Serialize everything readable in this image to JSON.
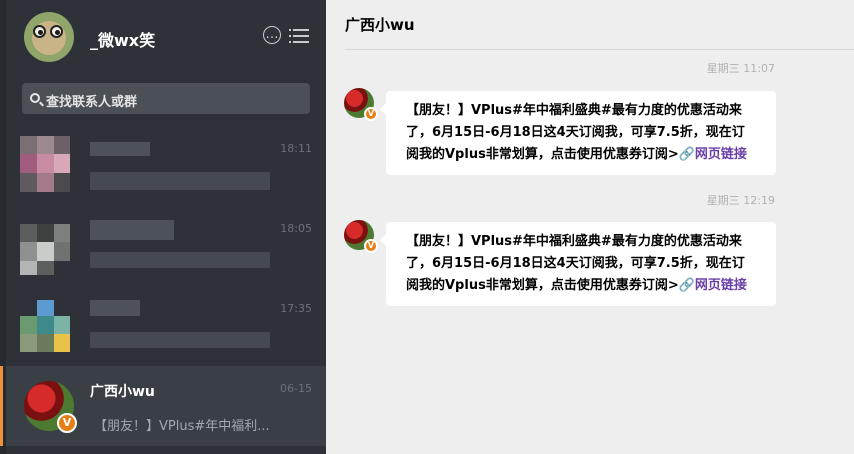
{
  "sidebar": {
    "user_name": "_微wx笑",
    "search_placeholder": "查找联系人或群",
    "conversations": [
      {
        "time": "18:11"
      },
      {
        "time": "18:05"
      },
      {
        "time": "17:35"
      },
      {
        "name": "广西小wu",
        "time": "06-15",
        "preview": "【朋友！】VPlus#年中福利...",
        "badge": "V"
      }
    ]
  },
  "chat": {
    "title": "广西小wu",
    "messages": [
      {
        "timestamp": "星期三 11:07",
        "text": "【朋友！】VPlus#年中福利盛典#最有力度的优惠活动来了，6月15日-6月18日这4天订阅我，可享7.5折，现在订阅我的Vplus非常划算，点击使用优惠券订阅>",
        "link": "网页链接"
      },
      {
        "timestamp": "星期三 12:19",
        "text": "【朋友！】VPlus#年中福利盛典#最有力度的优惠活动来了，6月15日-6月18日这4天订阅我，可享7.5折，现在订阅我的Vplus非常划算，点击使用优惠券订阅>",
        "link": "网页链接"
      }
    ]
  },
  "colors": {
    "sidebar_bg": "#2e3238",
    "active_row": "#3a3f45",
    "accent": "#f3913a",
    "link": "#6a3ea8"
  }
}
